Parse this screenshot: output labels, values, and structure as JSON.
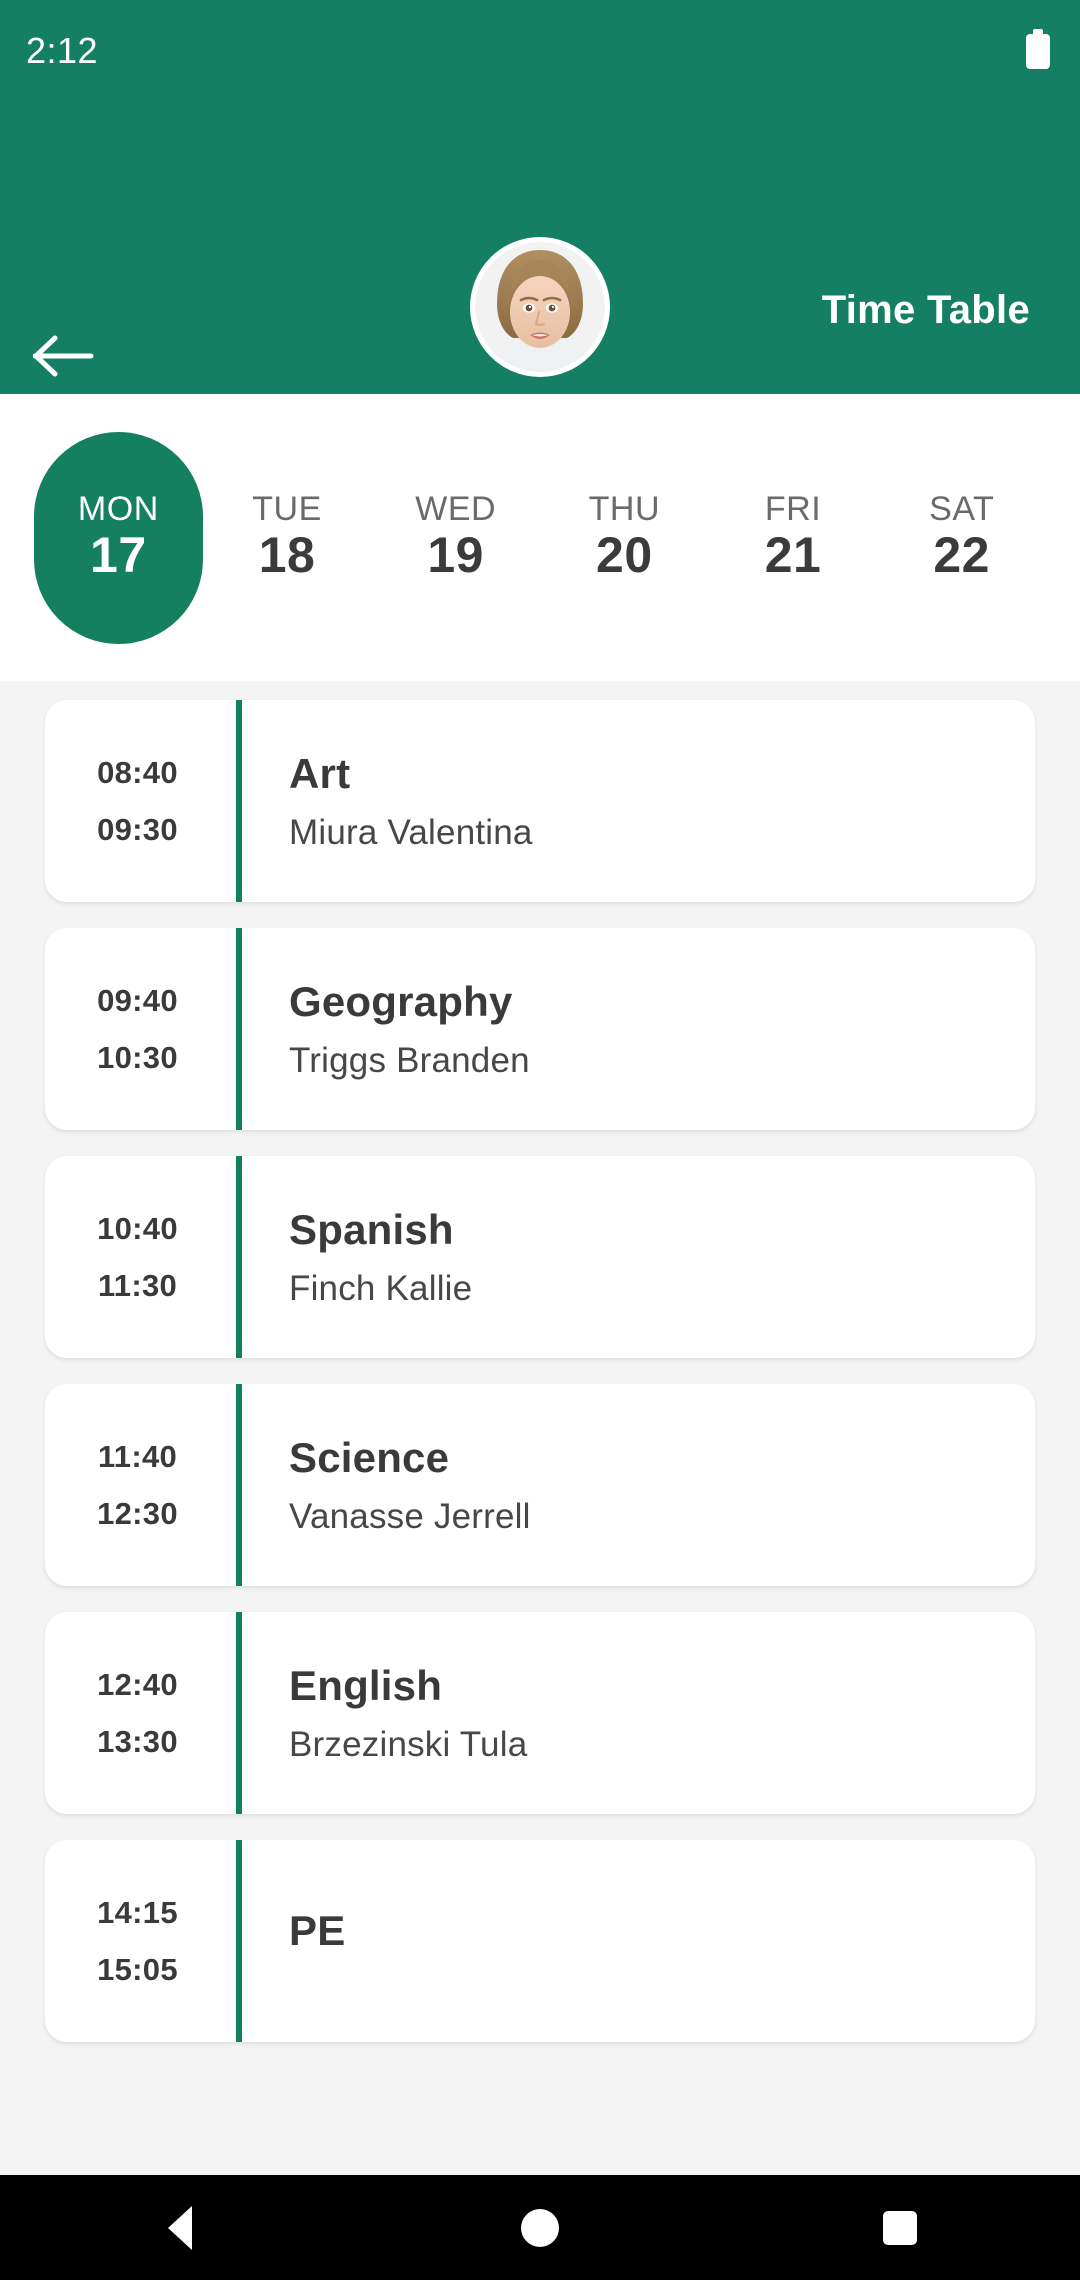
{
  "status_bar": {
    "time": "2:12",
    "battery_icon": "battery-icon"
  },
  "app_bar": {
    "back_icon": "back-arrow-icon",
    "title": "Time Table",
    "avatar_alt": "student-avatar"
  },
  "day_strip": {
    "days": [
      {
        "dow": "MON",
        "num": "17",
        "selected": true
      },
      {
        "dow": "TUE",
        "num": "18",
        "selected": false
      },
      {
        "dow": "WED",
        "num": "19",
        "selected": false
      },
      {
        "dow": "THU",
        "num": "20",
        "selected": false
      },
      {
        "dow": "FRI",
        "num": "21",
        "selected": false
      },
      {
        "dow": "SAT",
        "num": "22",
        "selected": false
      }
    ]
  },
  "lessons": [
    {
      "start": "08:40",
      "end": "09:30",
      "subject": "Art",
      "teacher": "Miura Valentina"
    },
    {
      "start": "09:40",
      "end": "10:30",
      "subject": "Geography",
      "teacher": "Triggs Branden"
    },
    {
      "start": "10:40",
      "end": "11:30",
      "subject": "Spanish",
      "teacher": "Finch Kallie"
    },
    {
      "start": "11:40",
      "end": "12:30",
      "subject": "Science",
      "teacher": "Vanasse Jerrell"
    },
    {
      "start": "12:40",
      "end": "13:30",
      "subject": "English",
      "teacher": "Brzezinski Tula"
    },
    {
      "start": "14:15",
      "end": "15:05",
      "subject": "PE",
      "teacher": ""
    }
  ],
  "nav_bar": {
    "back_icon": "nav-back-triangle-icon",
    "home_icon": "nav-home-circle-icon",
    "recents_icon": "nav-recents-square-icon"
  },
  "colors": {
    "primary": "#147F62",
    "accent": "#11805E",
    "surface": "#ffffff",
    "background": "#f4f4f4",
    "text_primary": "#3a3a3a",
    "text_secondary": "#6a6a6a"
  }
}
